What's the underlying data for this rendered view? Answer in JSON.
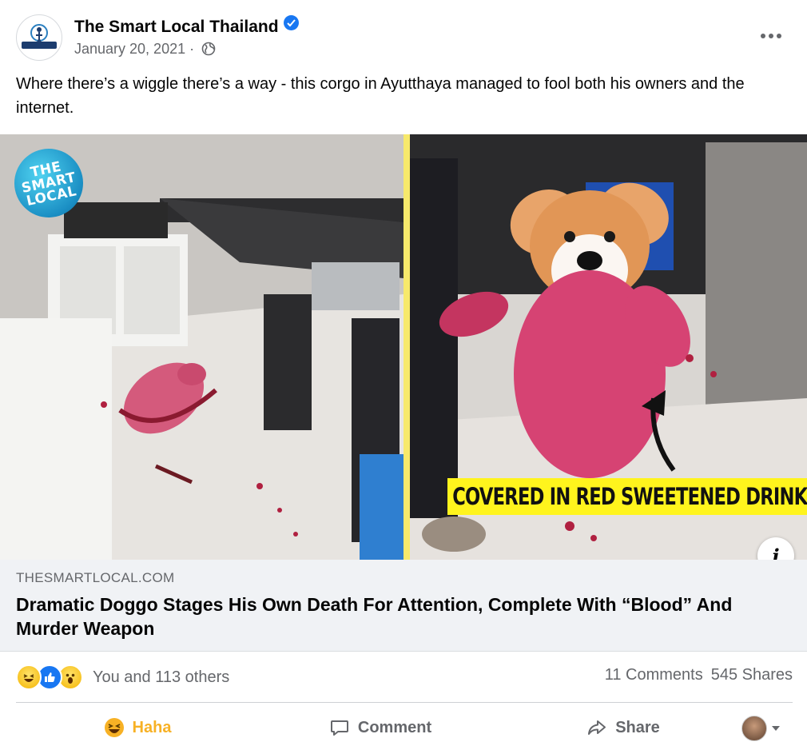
{
  "post": {
    "page_name": "The Smart Local Thailand",
    "date": "January 20, 2021",
    "separator": "·",
    "caption": "Where there’s a wiggle there’s a way - this corgo in Ayutthaya managed to fool both his owners and the internet."
  },
  "media": {
    "logo_lines": [
      "THE",
      "SMART",
      "LOCAL"
    ],
    "overlay_label": "COVERED IN RED SWEETENED DRINK",
    "info_glyph": "i",
    "divider_color": "#f7e96b",
    "label_color": "#fff41d"
  },
  "link": {
    "domain": "THESMARTLOCAL.COM",
    "title": "Dramatic Doggo Stages His Own Death For Attention, Complete With “Blood” And Murder Weapon"
  },
  "stats": {
    "reaction_icons": [
      "haha-icon",
      "like-icon",
      "wow-icon"
    ],
    "reactions_text": "You and 113 others",
    "comments": "11 Comments",
    "shares": "545 Shares"
  },
  "actions": {
    "haha": "Haha",
    "comment": "Comment",
    "share": "Share"
  },
  "colors": {
    "brand_blue": "#1877f2",
    "haha_yellow": "#f7b125",
    "muted_text": "#65676b"
  }
}
